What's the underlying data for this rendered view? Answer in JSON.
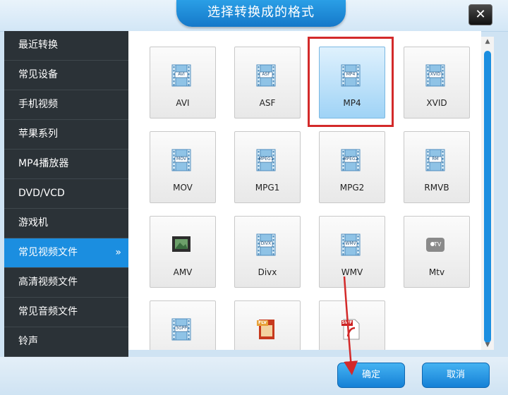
{
  "dialog": {
    "title": "选择转换成的格式",
    "close_label": "✕"
  },
  "sidebar": {
    "items": [
      {
        "label": "最近转换"
      },
      {
        "label": "常见设备"
      },
      {
        "label": "手机视频"
      },
      {
        "label": "苹果系列"
      },
      {
        "label": "MP4播放器"
      },
      {
        "label": "DVD/VCD"
      },
      {
        "label": "游戏机"
      },
      {
        "label": "常见视频文件",
        "active": true
      },
      {
        "label": "高清视频文件"
      },
      {
        "label": "常见音频文件"
      },
      {
        "label": "铃声"
      }
    ],
    "active_chevron": "»"
  },
  "formats": [
    {
      "label": "AVI",
      "badge": "AVI",
      "icon": "film-icon"
    },
    {
      "label": "ASF",
      "badge": "ASF",
      "icon": "film-icon"
    },
    {
      "label": "MP4",
      "badge": "MP4",
      "icon": "film-icon",
      "selected": true
    },
    {
      "label": "XVID",
      "badge": "XVID",
      "icon": "film-icon"
    },
    {
      "label": "MOV",
      "badge": "MOV",
      "icon": "film-icon"
    },
    {
      "label": "MPG1",
      "badge": "MPEG1",
      "icon": "film-icon"
    },
    {
      "label": "MPG2",
      "badge": "MPEG2",
      "icon": "film-icon"
    },
    {
      "label": "RMVB",
      "badge": "RM",
      "icon": "film-icon"
    },
    {
      "label": "AMV",
      "badge": "",
      "icon": "amv-film-icon"
    },
    {
      "label": "Divx",
      "badge": "DIVX",
      "icon": "film-icon"
    },
    {
      "label": "WMV",
      "badge": "WMV",
      "icon": "film-icon"
    },
    {
      "label": "Mtv",
      "badge": "TV",
      "icon": "apple-tv-icon"
    },
    {
      "label": "",
      "badge": "3GPP",
      "icon": "film-icon"
    },
    {
      "label": "",
      "badge": "FLV",
      "icon": "flv-icon"
    },
    {
      "label": "",
      "badge": "SWF",
      "icon": "swf-icon"
    }
  ],
  "buttons": {
    "ok": "确定",
    "cancel": "取消"
  },
  "colors": {
    "accent": "#1b8ee0",
    "sidebar_bg": "#2b3237",
    "highlight": "#d32a2a",
    "arrow": "#d32a2a"
  }
}
